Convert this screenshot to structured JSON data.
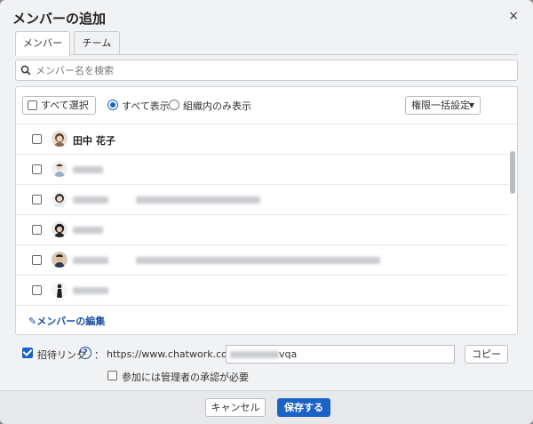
{
  "dialog": {
    "title": "メンバーの追加",
    "close_icon": "×"
  },
  "tabs": [
    {
      "label": "メンバー",
      "active": true
    },
    {
      "label": "チーム",
      "active": false
    }
  ],
  "search": {
    "placeholder": "メンバー名を検索",
    "value": ""
  },
  "toolbar": {
    "select_all_label": "すべて選択",
    "filter_all_label": "すべて表示",
    "filter_org_label": "組織内のみ表示",
    "filter_selected": "all",
    "bulk_permission_label": "権限一括設定",
    "bulk_caret": "▼"
  },
  "members": [
    {
      "name": "田中 花子",
      "checked": false
    }
  ],
  "edit_members_label": "メンバーの編集",
  "invite": {
    "label": "招待リンク",
    "help_icon": "?",
    "colon": "：",
    "enabled": true,
    "url_prefix": "https://www.chatwork.com/g/",
    "url_suffix": "vqa",
    "copy_label": "コピー",
    "approval_label": "参加には管理者の承認が必要",
    "approval_checked": false
  },
  "footer": {
    "cancel_label": "キャンセル",
    "save_label": "保存する"
  },
  "colors": {
    "accent": "#1b62c6",
    "link": "#1b4f9c"
  }
}
